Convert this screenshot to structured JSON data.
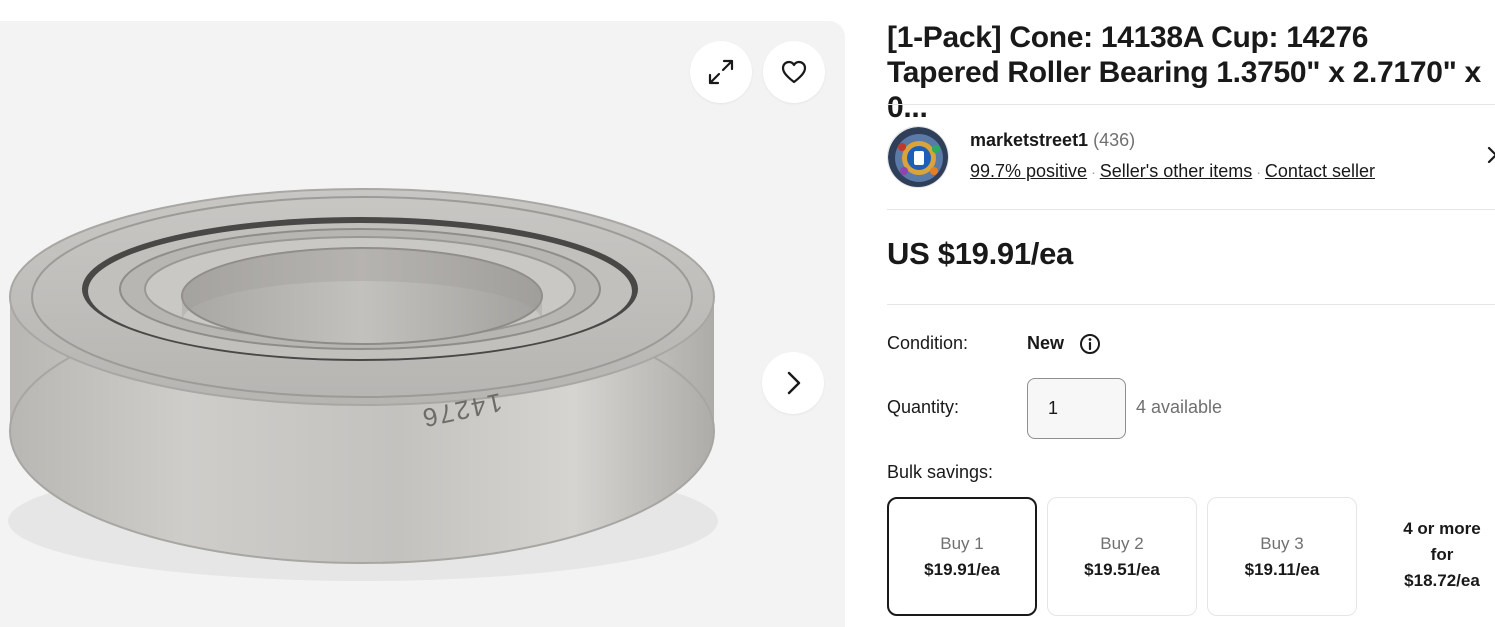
{
  "gallery": {
    "engraving": "14276",
    "buttons": {
      "expand": "expand-icon",
      "favorite": "heart-icon",
      "next": "chevron-right-icon"
    }
  },
  "listing": {
    "title": "[1-Pack] Cone: 14138A Cup: 14276 Tapered Roller Bearing 1.3750\" x 2.7170\" x 0..."
  },
  "seller": {
    "name": "marketstreet1",
    "feedback_count": "(436)",
    "positive": "99.7% positive",
    "other_items": "Seller's other items",
    "contact": "Contact seller",
    "separator": "·"
  },
  "price": {
    "display": "US $19.91/ea"
  },
  "condition": {
    "label": "Condition:",
    "value": "New"
  },
  "quantity": {
    "label": "Quantity:",
    "value": "1",
    "available": "4 available"
  },
  "bulk": {
    "label": "Bulk savings:",
    "options": [
      {
        "qty": "Buy 1",
        "price": "$19.91/ea",
        "selected": true
      },
      {
        "qty": "Buy 2",
        "price": "$19.51/ea",
        "selected": false
      },
      {
        "qty": "Buy 3",
        "price": "$19.11/ea",
        "selected": false
      }
    ],
    "more": {
      "line1": "4 or more",
      "line2": "for",
      "line3": "$18.72/ea"
    }
  },
  "colors": {
    "text": "#191919",
    "muted": "#707070",
    "border": "#e5e5e5",
    "gallery_bg": "#f3f3f3"
  }
}
